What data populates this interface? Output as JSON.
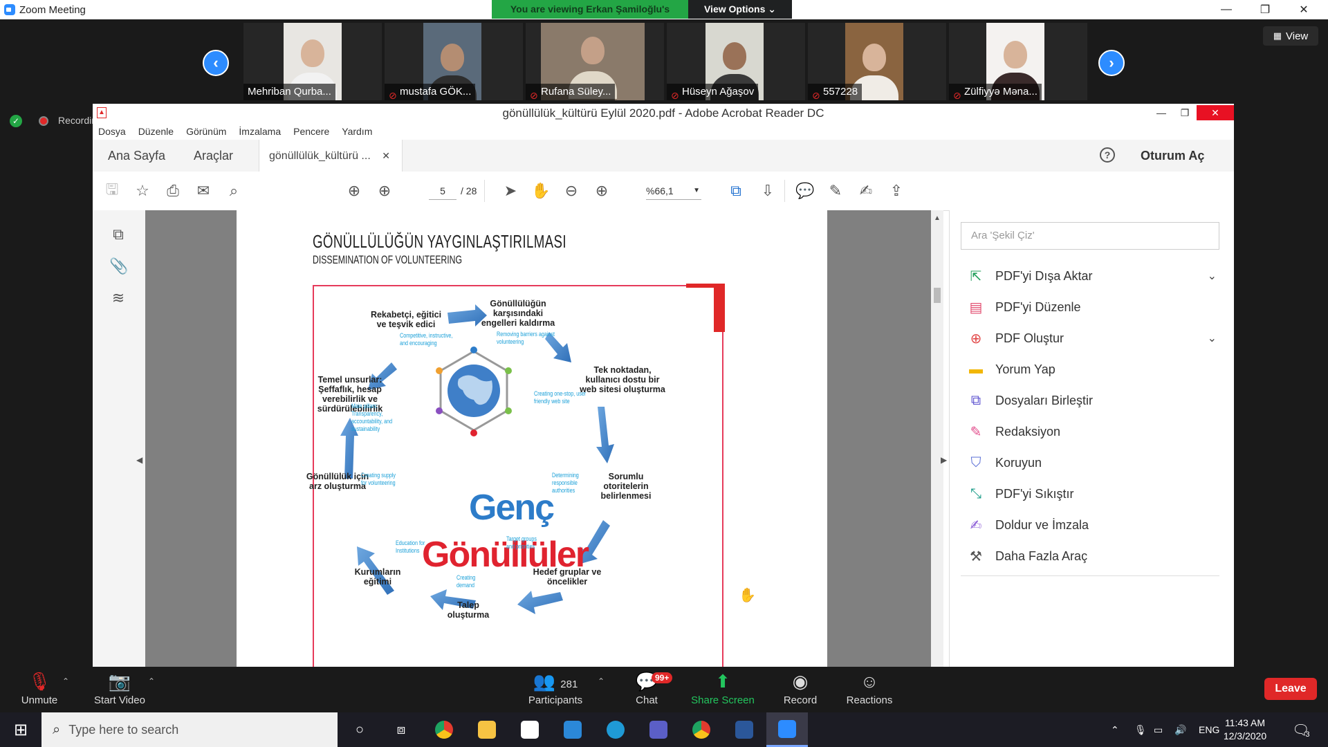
{
  "zoom": {
    "window_title": "Zoom Meeting",
    "banner_text": "You are viewing Erkan Şamiloğlu's screen",
    "view_options": "View Options ⌄",
    "view_button": "View",
    "recording_label": "Recording",
    "participants": [
      {
        "name": "Mehriban Qurba...",
        "muted": false
      },
      {
        "name": "mustafa GÖK...",
        "muted": true
      },
      {
        "name": "Rufana Süley...",
        "muted": true
      },
      {
        "name": "Hüseyn Ağaşov",
        "muted": true
      },
      {
        "name": "557228",
        "muted": true
      },
      {
        "name": "Zülfiyyə Məna...",
        "muted": true
      }
    ],
    "bottom_bar": {
      "unmute": "Unmute",
      "start_video": "Start Video",
      "participants": "Participants",
      "participants_count": "281",
      "chat": "Chat",
      "chat_badge": "99+",
      "share_screen": "Share Screen",
      "record": "Record",
      "reactions": "Reactions",
      "leave": "Leave"
    }
  },
  "acrobat": {
    "title": "gönüllülük_kültürü Eylül 2020.pdf - Adobe Acrobat Reader DC",
    "menu": [
      "Dosya",
      "Düzenle",
      "Görünüm",
      "İmzalama",
      "Pencere",
      "Yardım"
    ],
    "tabs": {
      "home": "Ana Sayfa",
      "tools": "Araçlar",
      "doc": "gönüllülük_kültürü ...",
      "login": "Oturum Aç"
    },
    "toolbar": {
      "page": "5",
      "page_total": "/ 28",
      "zoom": "%66,1"
    },
    "search_placeholder": "Ara 'Şekil Çiz'",
    "tools": [
      {
        "label": "PDF'yi Dışa Aktar",
        "icon": "export-pdf-icon",
        "color": "#1f9e5a",
        "expand": true
      },
      {
        "label": "PDF'yi Düzenle",
        "icon": "edit-pdf-icon",
        "color": "#e24a6d",
        "expand": false
      },
      {
        "label": "PDF Oluştur",
        "icon": "create-pdf-icon",
        "color": "#e24a4a",
        "expand": true
      },
      {
        "label": "Yorum Yap",
        "icon": "comment-icon",
        "color": "#f2b705",
        "expand": false
      },
      {
        "label": "Dosyaları Birleştir",
        "icon": "combine-files-icon",
        "color": "#5a4fcf",
        "expand": false
      },
      {
        "label": "Redaksiyon",
        "icon": "redact-icon",
        "color": "#e24a8a",
        "expand": false
      },
      {
        "label": "Koruyun",
        "icon": "protect-icon",
        "color": "#5a6fd6",
        "expand": false
      },
      {
        "label": "PDF'yi Sıkıştır",
        "icon": "compress-icon",
        "color": "#1f9e8a",
        "expand": false
      },
      {
        "label": "Doldur ve İmzala",
        "icon": "fill-sign-icon",
        "color": "#8a5ad6",
        "expand": false
      },
      {
        "label": "Daha Fazla Araç",
        "icon": "more-tools-icon",
        "color": "#555555",
        "expand": false
      }
    ]
  },
  "document": {
    "title": "GÖNÜLLÜLÜĞÜN YAYGINLAŞTIRILMASI",
    "subtitle": "DISSEMINATION OF VOLUNTEERING",
    "center_top": "Genç",
    "center_bottom": "Gönüllüler",
    "nodes": [
      {
        "tr": "Gönüllülüğün karşısındaki engelleri kaldırma",
        "en": "Removing barriers against volunteering"
      },
      {
        "tr": "Tek noktadan, kullanıcı dostu bir web sitesi oluşturma",
        "en": "Creating one-stop, user friendly web site"
      },
      {
        "tr": "Sorumlu otoritelerin belirlenmesi",
        "en": "Determining responsible authorities"
      },
      {
        "tr": "Hedef gruplar ve öncelikler",
        "en": "Target groups and priorities"
      },
      {
        "tr": "Talep oluşturma",
        "en": "Creating demand"
      },
      {
        "tr": "Kurumların eğitimi",
        "en": "Education for Institutions"
      },
      {
        "tr": "Gönüllülük için arz oluşturma",
        "en": "Creating supply for volunteering"
      },
      {
        "tr": "Temel unsurlar: Şeffaflık, hesap verebilirlik ve sürdürülebilirlik",
        "en": "Main pillars: Transparency, accountability, and sustainability"
      },
      {
        "tr": "Rekabetçi, eğitici ve teşvik edici",
        "en": "Competitive, instructive, and encouraging"
      }
    ]
  },
  "taskbar": {
    "search_placeholder": "Type here to search",
    "language": "ENG",
    "time": "11:43 AM",
    "date": "12/3/2020",
    "notifications": "3"
  }
}
